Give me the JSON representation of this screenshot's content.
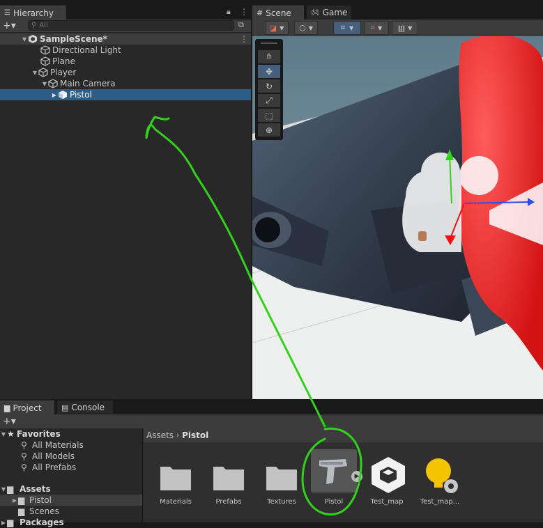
{
  "hierarchy": {
    "tab_label": "Hierarchy",
    "search_placeholder": "All",
    "scene_name": "SampleScene*",
    "items": [
      {
        "label": "Directional Light"
      },
      {
        "label": "Plane"
      },
      {
        "label": "Player"
      },
      {
        "label": "Main Camera"
      },
      {
        "label": "Pistol"
      }
    ]
  },
  "scene": {
    "tabs": [
      {
        "label": "Scene"
      },
      {
        "label": "Game"
      }
    ]
  },
  "project": {
    "tabs": [
      {
        "label": "Project"
      },
      {
        "label": "Console"
      }
    ],
    "favorites": {
      "label": "Favorites",
      "items": [
        {
          "label": "All Materials"
        },
        {
          "label": "All Models"
        },
        {
          "label": "All Prefabs"
        }
      ]
    },
    "assets_root": "Assets",
    "folders": [
      {
        "label": "Pistol"
      },
      {
        "label": "Scenes"
      }
    ],
    "packages": "Packages",
    "breadcrumb": {
      "root": "Assets",
      "current": "Pistol"
    },
    "grid": [
      {
        "label": "Materials"
      },
      {
        "label": "Prefabs"
      },
      {
        "label": "Textures"
      },
      {
        "label": "Pistol"
      },
      {
        "label": "Test_map"
      },
      {
        "label": "Test_map..."
      }
    ]
  },
  "colors": {
    "selection": "#2c5d87",
    "annotation": "#33d11c"
  }
}
